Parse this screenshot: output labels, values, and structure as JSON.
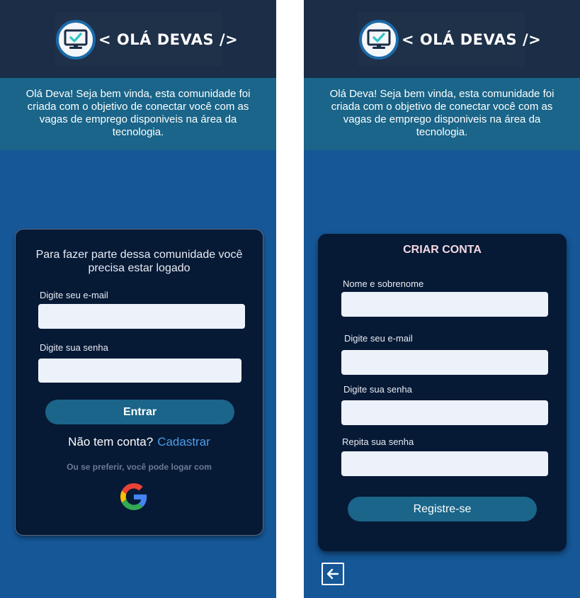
{
  "brand": {
    "logo_text": "< OLÁ DEVAS />",
    "logo_icon": "monitor-check-icon"
  },
  "intro_text": "Olá Deva! Seja bem vinda, esta comunidade foi criada com o objetivo de conectar você com as vagas de emprego disponiveis na área da tecnologia.",
  "login": {
    "message": "Para fazer parte dessa comunidade você precisa estar logado",
    "email_label": "Digite seu e-mail",
    "email_value": "",
    "password_label": "Digite sua senha",
    "password_value": "",
    "submit_label": "Entrar",
    "no_account_text": "Não tem conta?",
    "register_link": "Cadastrar",
    "alt_text": "Ou se preferir, você pode logar com",
    "google_icon": "google-icon"
  },
  "signup": {
    "title": "CRIAR CONTA",
    "name_label": "Nome e sobrenome",
    "name_value": "",
    "email_label": "Digite seu e-mail",
    "email_value": "",
    "password_label": "Digite sua senha",
    "password_value": "",
    "repeat_label": "Repita sua senha",
    "repeat_value": "",
    "submit_label": "Registre-se",
    "back_icon": "arrow-left-icon"
  },
  "colors": {
    "page_bg": "#155797",
    "header_bg": "#1b2d47",
    "intro_bg": "#1a6589",
    "card_bg": "#061935",
    "input_bg": "#edf1f9",
    "button_bg": "#1a6589",
    "link": "#4f9de6"
  }
}
